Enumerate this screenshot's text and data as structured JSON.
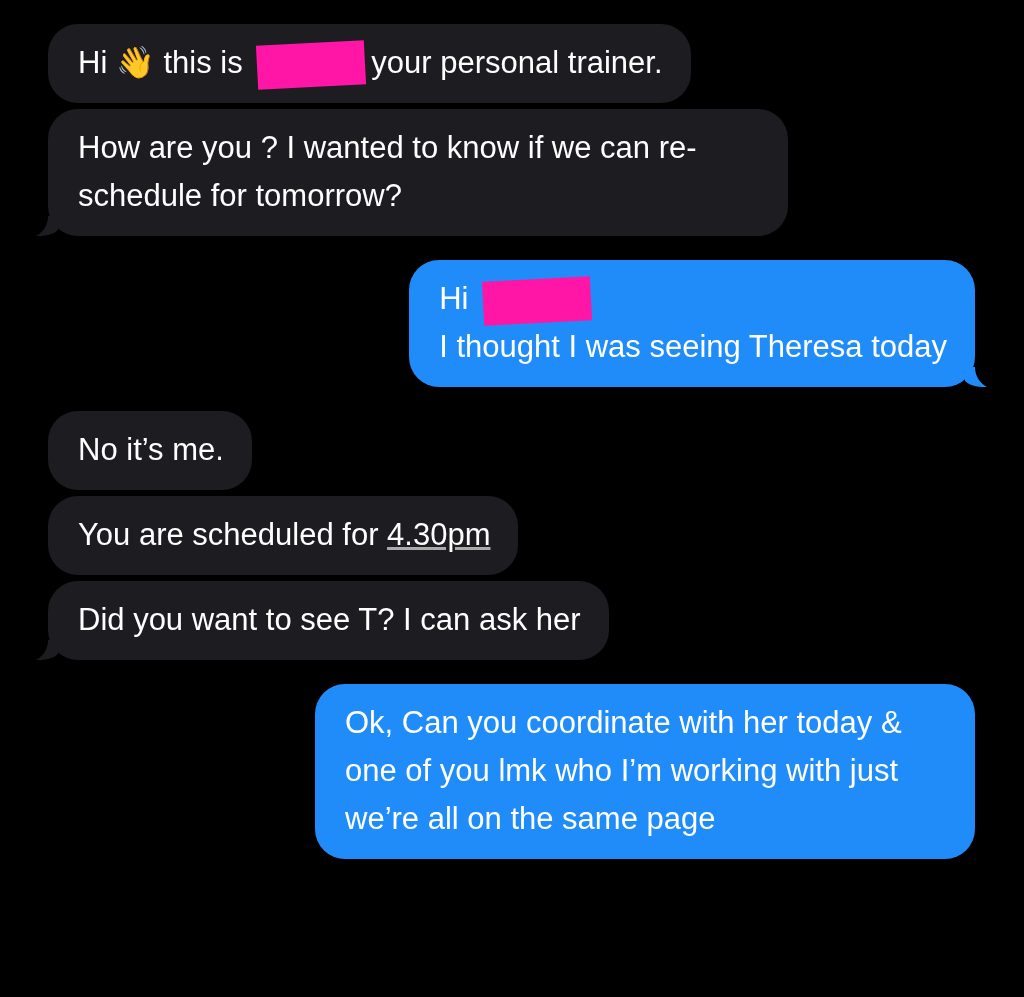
{
  "messages": [
    {
      "kind": "incoming",
      "tail": false,
      "segments": [
        {
          "kind": "text",
          "text": "Hi 👋 this is"
        },
        {
          "kind": "redacted"
        },
        {
          "kind": "text",
          "text": "your personal trainer."
        }
      ]
    },
    {
      "kind": "incoming",
      "tail": true,
      "segments": [
        {
          "kind": "text",
          "text": "How are you ? I wanted to know if we can re-schedule for tomorrow?"
        }
      ]
    },
    {
      "kind": "outgoing",
      "tail": true,
      "segments": [
        {
          "kind": "text",
          "text": "Hi"
        },
        {
          "kind": "redacted"
        },
        {
          "kind": "break"
        },
        {
          "kind": "text",
          "text": "I thought I was seeing Theresa today"
        }
      ]
    },
    {
      "kind": "incoming",
      "tail": false,
      "segments": [
        {
          "kind": "text",
          "text": "No it’s me."
        }
      ]
    },
    {
      "kind": "incoming",
      "tail": false,
      "segments": [
        {
          "kind": "text",
          "text": "You are scheduled for"
        },
        {
          "kind": "link",
          "text": "4.30pm"
        }
      ]
    },
    {
      "kind": "incoming",
      "tail": true,
      "segments": [
        {
          "kind": "text",
          "text": "Did you want to see T? I can ask her"
        }
      ]
    },
    {
      "kind": "outgoing",
      "tail": false,
      "segments": [
        {
          "kind": "text",
          "text": "Ok, Can you coordinate with her today & one of you lmk who I’m working with just we’re all on the same page"
        }
      ]
    }
  ]
}
